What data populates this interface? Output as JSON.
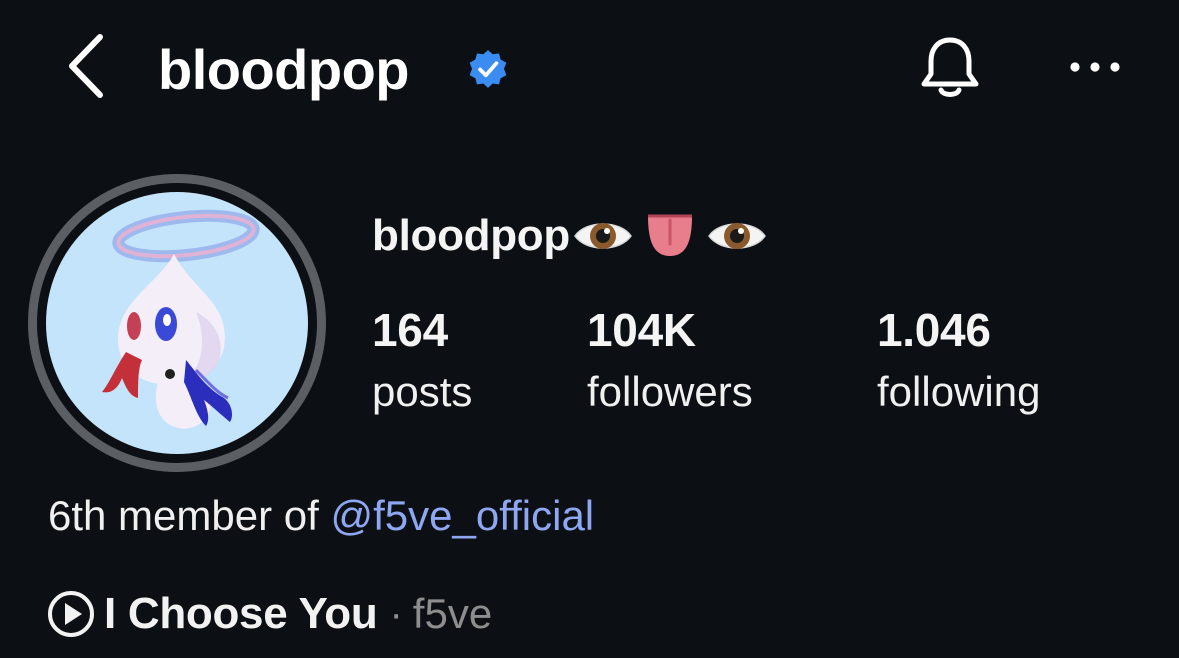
{
  "header": {
    "title": "bloodpop",
    "verified_color": "#3b8cf2",
    "back_icon": "chevron-left-icon",
    "bell_icon": "bell-icon",
    "more_icon": "more-horizontal-icon"
  },
  "profile": {
    "name": "bloodpop",
    "name_emojis": [
      "eye",
      "tongue",
      "eye"
    ],
    "stats": [
      {
        "value": "164",
        "label": "posts"
      },
      {
        "value": "104K",
        "label": "followers"
      },
      {
        "value": "1.046",
        "label": "following"
      }
    ]
  },
  "bio": {
    "text": "6th member of ",
    "mention": "@f5ve_official",
    "mention_color": "#8fa6f2"
  },
  "music": {
    "icon": "play-circle-icon",
    "title": "I Choose You",
    "separator": "·",
    "artist": "f5ve"
  }
}
